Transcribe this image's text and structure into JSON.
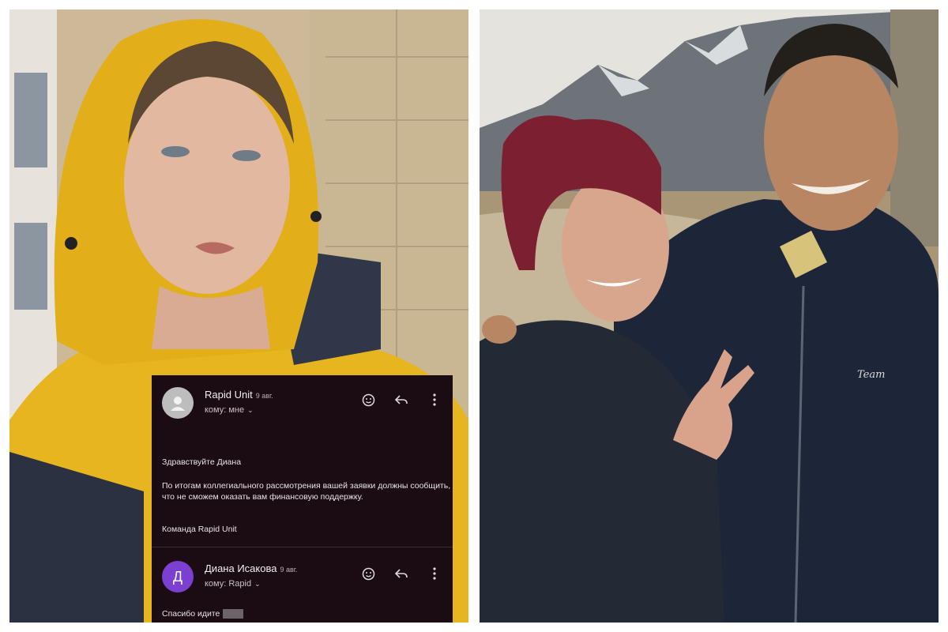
{
  "email": {
    "message1": {
      "sender": "Rapid Unit",
      "date": "9 авг.",
      "recipient": "кому: мне",
      "greeting": "Здравствуйте Диана",
      "body": "По итогам коллегиального рассмотрения вашей заявки должны сообщить, что не сможем оказать вам финансовую поддержку.",
      "signature": "Команда Rapid Unit"
    },
    "message2": {
      "avatar_letter": "Д",
      "sender": "Диана Исакова",
      "date": "9 авг.",
      "recipient": "кому: Rapid",
      "body": "Спасибо идите"
    },
    "icons": [
      "person-avatar-icon",
      "emoji-icon",
      "reply-icon",
      "more-vertical-icon",
      "chevron-down-icon"
    ]
  },
  "photo_right": {
    "jacket_logo": "Team"
  },
  "colors": {
    "email_bg": "#1a0c12",
    "avatar_purple": "#7b3fd1",
    "raincoat_yellow": "#e8b820"
  }
}
